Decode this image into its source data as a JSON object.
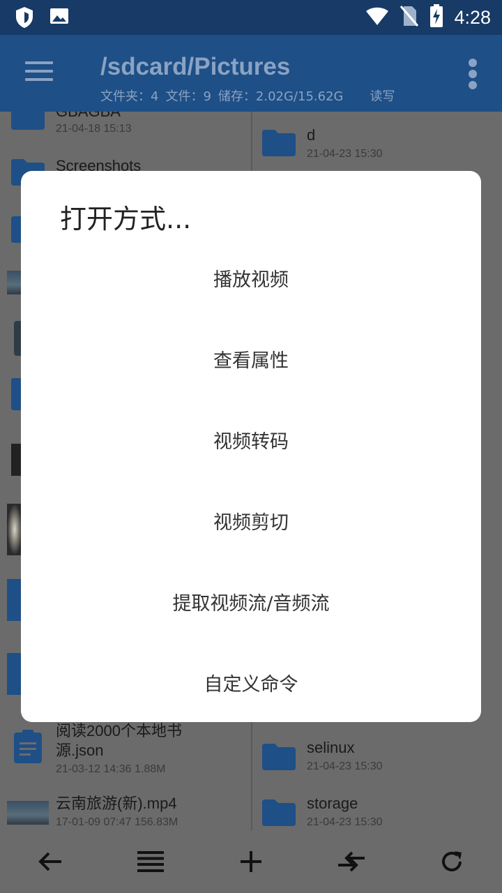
{
  "status_bar": {
    "time": "4:28",
    "left_icons": [
      "shield-icon",
      "image-icon"
    ],
    "right_icons": [
      "wifi-icon",
      "no-sim-icon",
      "battery-charging-icon"
    ]
  },
  "app_bar": {
    "path": "/sdcard/Pictures",
    "folders_label": "文件夹：",
    "folders_count": "4",
    "files_label": "文件：",
    "files_count": "9",
    "storage_label": "储存：",
    "storage_value": "2.02G/15.62G",
    "mode": "读写"
  },
  "left_pane": {
    "items": [
      {
        "name": "GBAGBA",
        "meta": "21-04-18 15:13",
        "icon": "folder-icon"
      },
      {
        "name": "Screenshots",
        "meta": "",
        "icon": "folder-icon"
      },
      {
        "name": "阅读2000个本地书\n源.json",
        "meta": "21-03-12 14:36  1.88M",
        "icon": "document-icon"
      },
      {
        "name": "云南旅游(新).mp4",
        "meta": "17-01-09 07:47  156.83M",
        "icon": "video-thumbnail"
      }
    ]
  },
  "right_pane": {
    "items": [
      {
        "name": "d",
        "meta": "21-04-23 15:30",
        "icon": "folder-icon"
      },
      {
        "name": "selinux",
        "meta": "21-04-23 15:30",
        "icon": "folder-icon"
      },
      {
        "name": "storage",
        "meta": "21-04-23 15:30",
        "icon": "folder-icon"
      }
    ]
  },
  "dialog": {
    "title": "打开方式...",
    "options": [
      "播放视频",
      "查看属性",
      "视频转码",
      "视频剪切",
      "提取视频流/音频流",
      "自定义命令"
    ]
  },
  "bottom_bar": {
    "buttons": [
      "back-arrow-icon",
      "list-icon",
      "plus-icon",
      "swap-icon",
      "refresh-icon"
    ]
  },
  "colors": {
    "status_bar": "#173a66",
    "app_bar": "#1e4f86",
    "folder": "#1e4f86",
    "scrim": "#6b6b6b"
  }
}
